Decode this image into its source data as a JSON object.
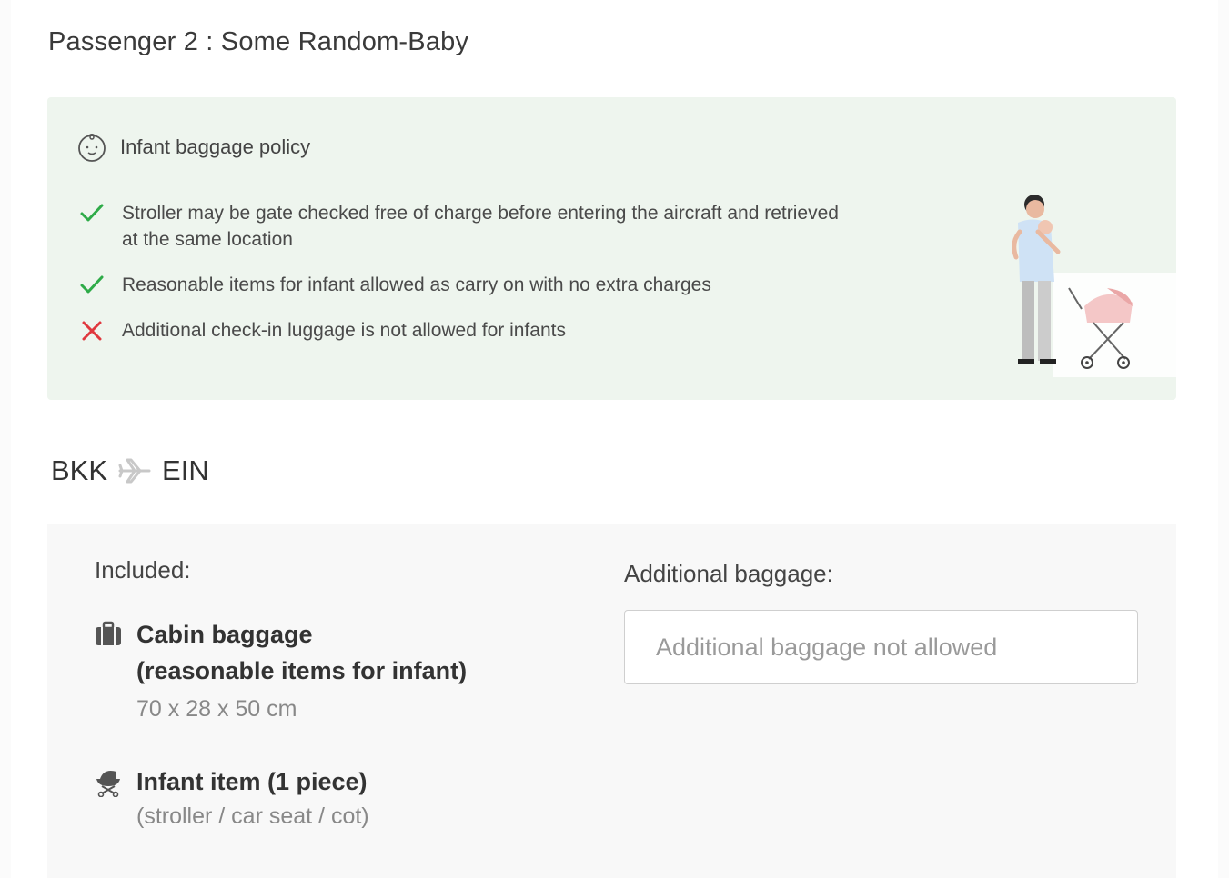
{
  "passenger": {
    "title": "Passenger 2 : Some Random-Baby"
  },
  "policy": {
    "header_icon": "baby-icon",
    "title": "Infant baggage policy",
    "items": [
      {
        "status": "allowed",
        "icon": "check-icon",
        "text": "Stroller may be gate checked free of charge before entering the aircraft and retrieved at the same location"
      },
      {
        "status": "allowed",
        "icon": "check-icon",
        "text": "Reasonable items for infant allowed as carry on with no extra charges"
      },
      {
        "status": "not-allowed",
        "icon": "cross-icon",
        "text": "Additional check-in luggage is not allowed for infants"
      }
    ],
    "illustration": "parent-with-baby-and-stroller-illustration"
  },
  "route": {
    "from": "BKK",
    "to": "EIN",
    "icon": "plane-icon"
  },
  "baggage": {
    "included_label": "Included:",
    "cabin": {
      "icon": "suitcase-icon",
      "title_line1": "Cabin baggage",
      "title_line2": "(reasonable items for infant)",
      "dimensions": "70 x 28 x 50 cm"
    },
    "infant_item": {
      "icon": "stroller-icon",
      "title": "Infant item (1 piece)",
      "subtitle": "(stroller / car seat / cot)"
    },
    "additional_label": "Additional baggage:",
    "additional_value": "Additional baggage not allowed"
  },
  "colors": {
    "check": "#2eab48",
    "cross": "#e0383e",
    "policy_bg": "#eef5ee",
    "baggage_bg": "#f8f8f8"
  }
}
